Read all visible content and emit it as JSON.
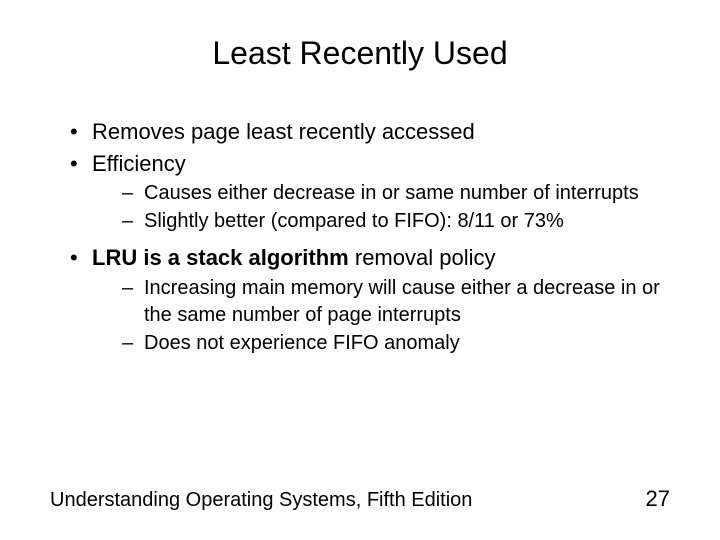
{
  "title": "Least Recently Used",
  "bullets": {
    "b1": "Removes page least recently accessed",
    "b2": "Efficiency",
    "b2_sub1": "Causes either decrease in or same number of interrupts",
    "b2_sub2": "Slightly better (compared to FIFO): 8/11 or 73%",
    "b3_bold": "LRU is a stack algorithm",
    "b3_rest": " removal policy",
    "b3_sub1": "Increasing main memory will cause either a decrease in or the same number of page interrupts",
    "b3_sub2": "Does not experience FIFO anomaly"
  },
  "footer": {
    "source": "Understanding Operating Systems, Fifth Edition",
    "page": "27"
  }
}
